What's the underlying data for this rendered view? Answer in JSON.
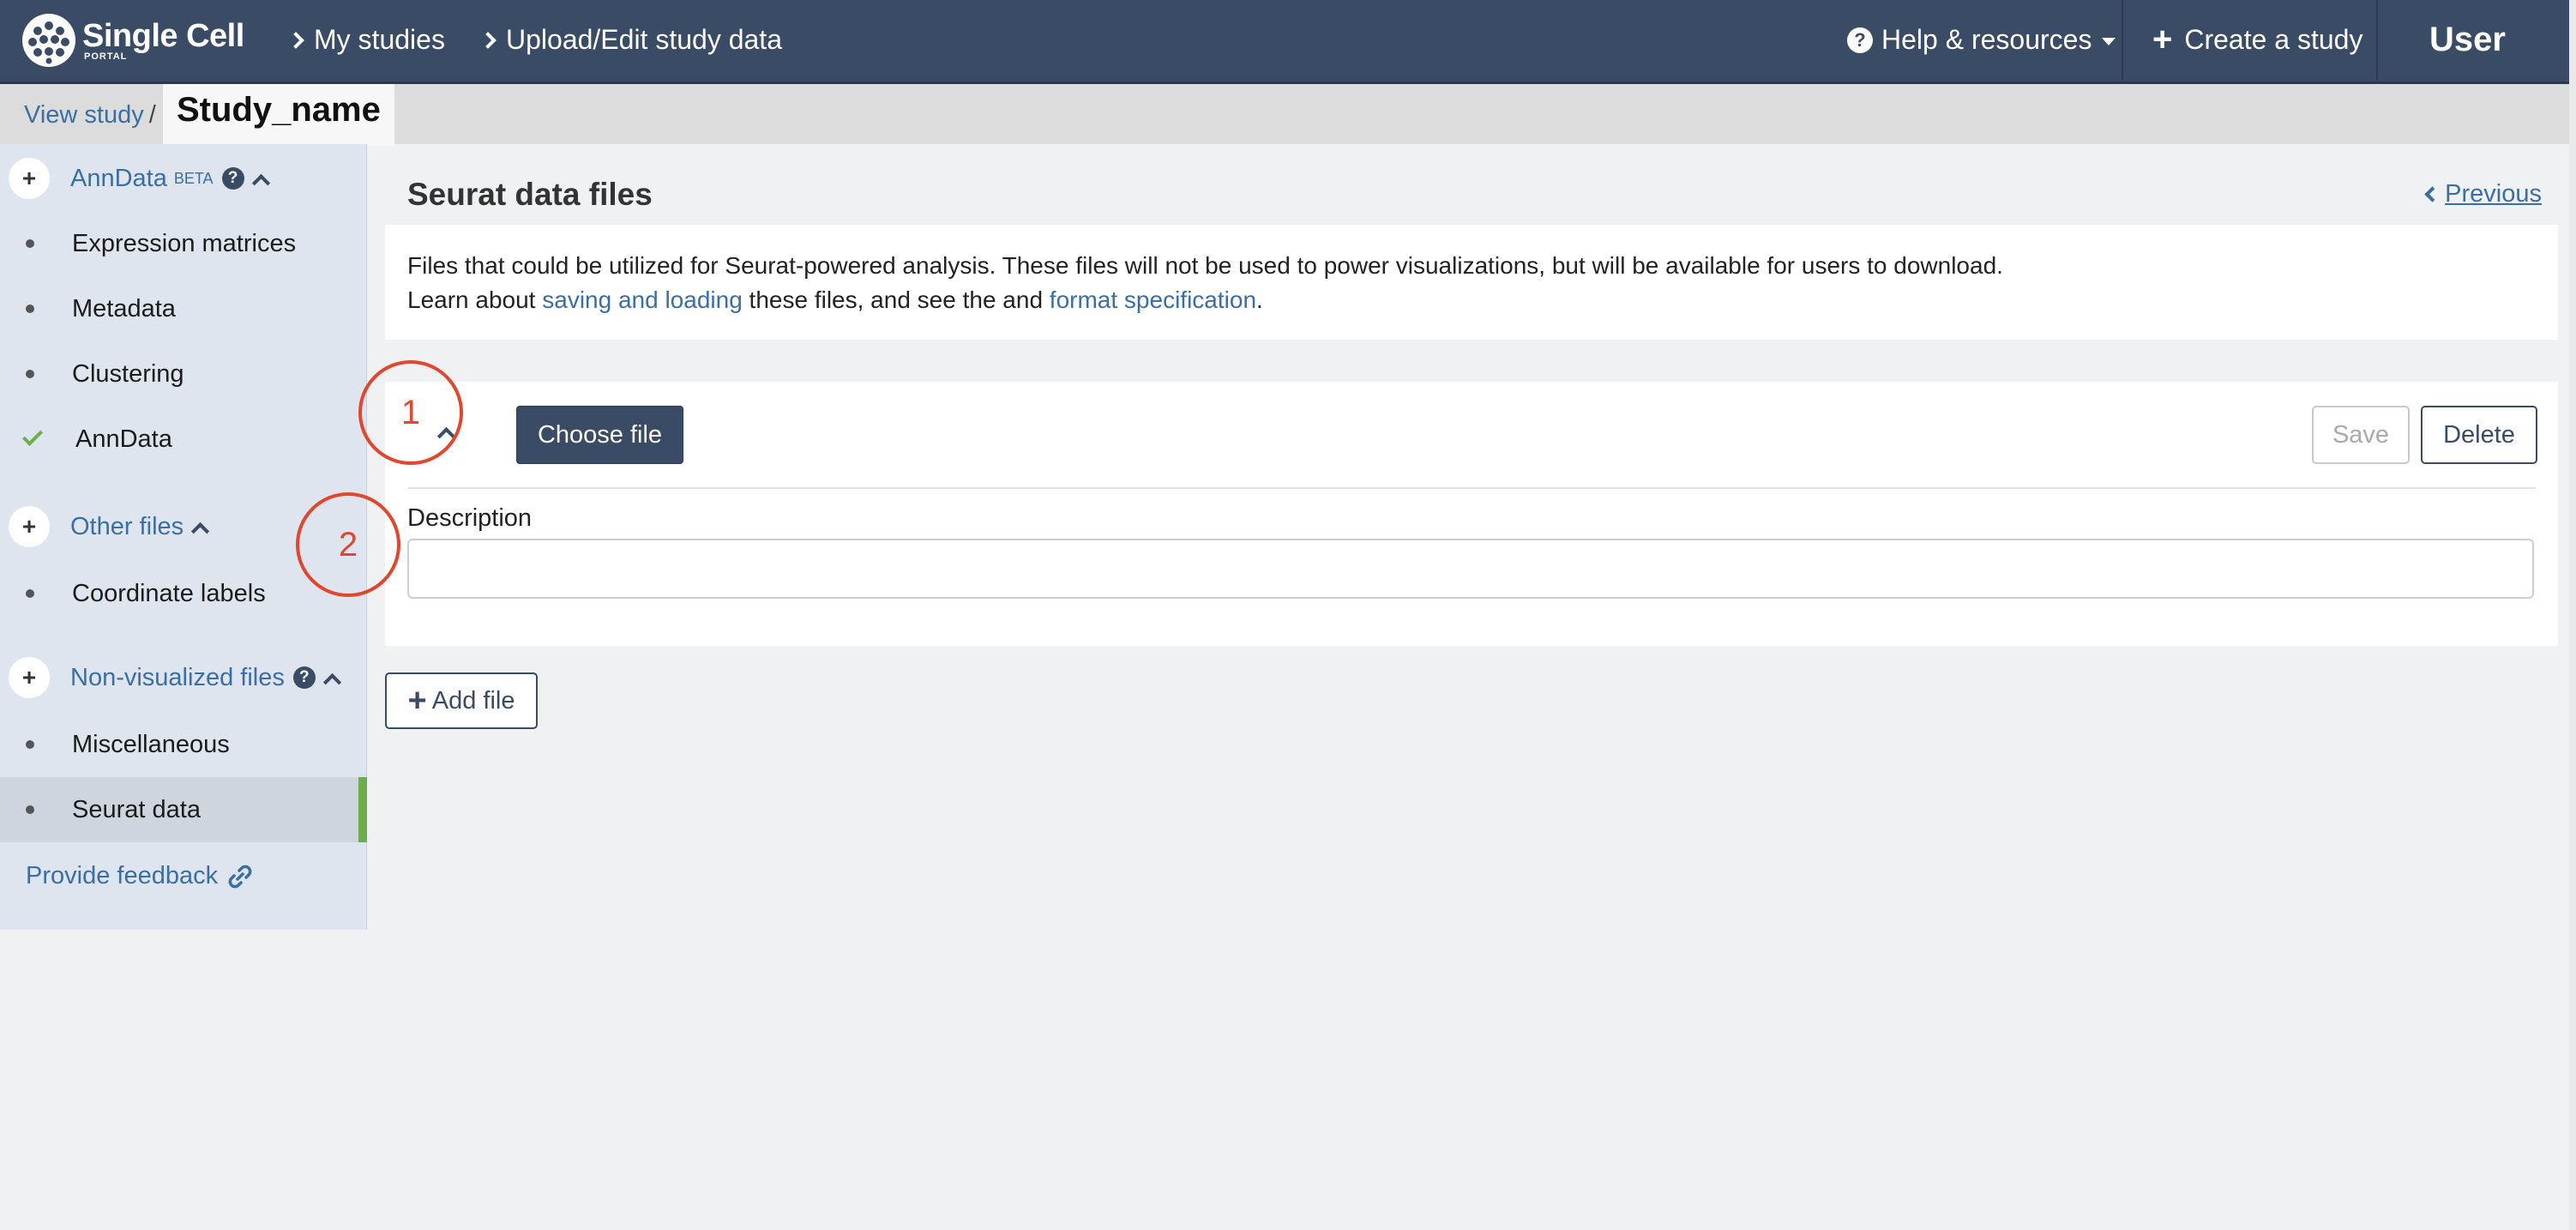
{
  "nav": {
    "logo_main": "Single Cell",
    "logo_sub": "PORTAL",
    "my_studies": "My studies",
    "upload_edit": "Upload/Edit study data",
    "help": "Help & resources",
    "create": "Create a study",
    "user": "User",
    "help_icon": "?",
    "plus_icon": "+"
  },
  "breadcrumb": {
    "view_study": "View study",
    "separator": "/",
    "study_name": "Study_name"
  },
  "sidebar": {
    "anndata_section": {
      "label": "AnnData",
      "badge": "BETA",
      "help": "?",
      "plus": "+"
    },
    "anndata_items": [
      "Expression matrices",
      "Metadata",
      "Clustering",
      "AnnData"
    ],
    "other_section": {
      "label": "Other files",
      "plus": "+"
    },
    "other_items": [
      "Coordinate labels"
    ],
    "nonvis_section": {
      "label": "Non-visualized files",
      "help": "?",
      "plus": "+"
    },
    "nonvis_items": [
      "Miscellaneous",
      "Seurat data"
    ],
    "active_item": "Seurat data",
    "feedback": "Provide feedback"
  },
  "main": {
    "title": "Seurat data files",
    "previous": "Previous",
    "info_line1": "Files that could be utilized for Seurat-powered analysis. These files will not be used to power visualizations, but will be available for users to download.",
    "info_line2_a": "Learn about ",
    "info_link1": "saving and loading",
    "info_line2_b": " these files, and see the  and ",
    "info_link2": "format specification",
    "info_line2_c": ".",
    "choose_file": "Choose file",
    "save": "Save",
    "delete": "Delete",
    "description_label": "Description",
    "description_value": "",
    "add_file": "Add file",
    "add_plus": "+"
  },
  "annotations": [
    "1",
    "2"
  ],
  "colors": {
    "nav_bg": "#3a4b66",
    "link": "#3a6ea5",
    "active_marker": "#6cae4b",
    "annotation": "#e0472f"
  }
}
